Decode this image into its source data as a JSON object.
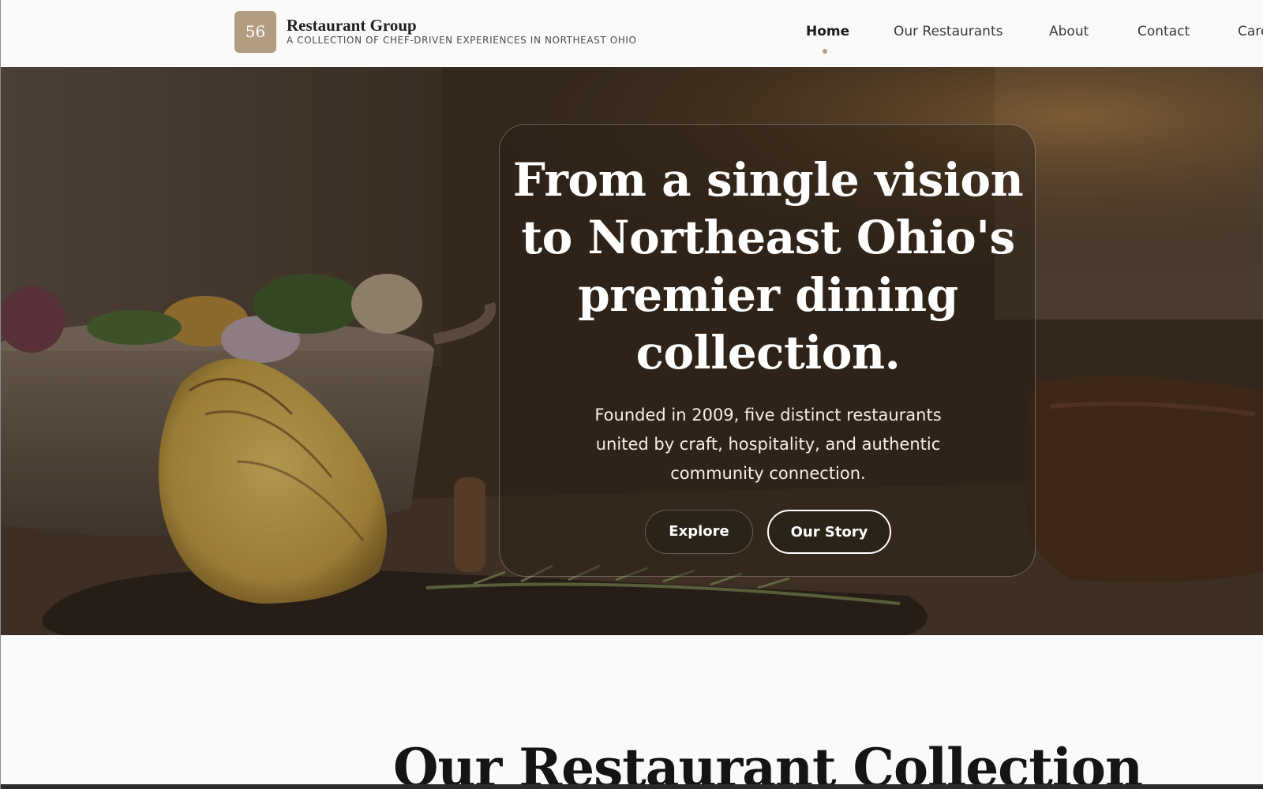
{
  "header": {
    "logo_text": "56",
    "brand_name": "Restaurant Group",
    "tagline": "A COLLECTION OF CHEF-DRIVEN EXPERIENCES IN NORTHEAST OHIO",
    "accent_color": "#b39d80"
  },
  "nav": {
    "items": [
      {
        "label": "Home",
        "active": true
      },
      {
        "label": "Our Restaurants",
        "active": false
      },
      {
        "label": "About",
        "active": false
      },
      {
        "label": "Contact",
        "active": false
      },
      {
        "label": "Care",
        "active": false
      }
    ]
  },
  "hero": {
    "title": "From a single vision to Northeast Ohio's premier dining collection.",
    "subtitle": "Founded in 2009, five distinct restaurants united by craft, hospitality, and authentic community connection.",
    "primary_button": "Explore",
    "secondary_button": "Our Story",
    "background_image": "food-photo"
  },
  "section": {
    "title": "Our Restaurant Collection"
  }
}
